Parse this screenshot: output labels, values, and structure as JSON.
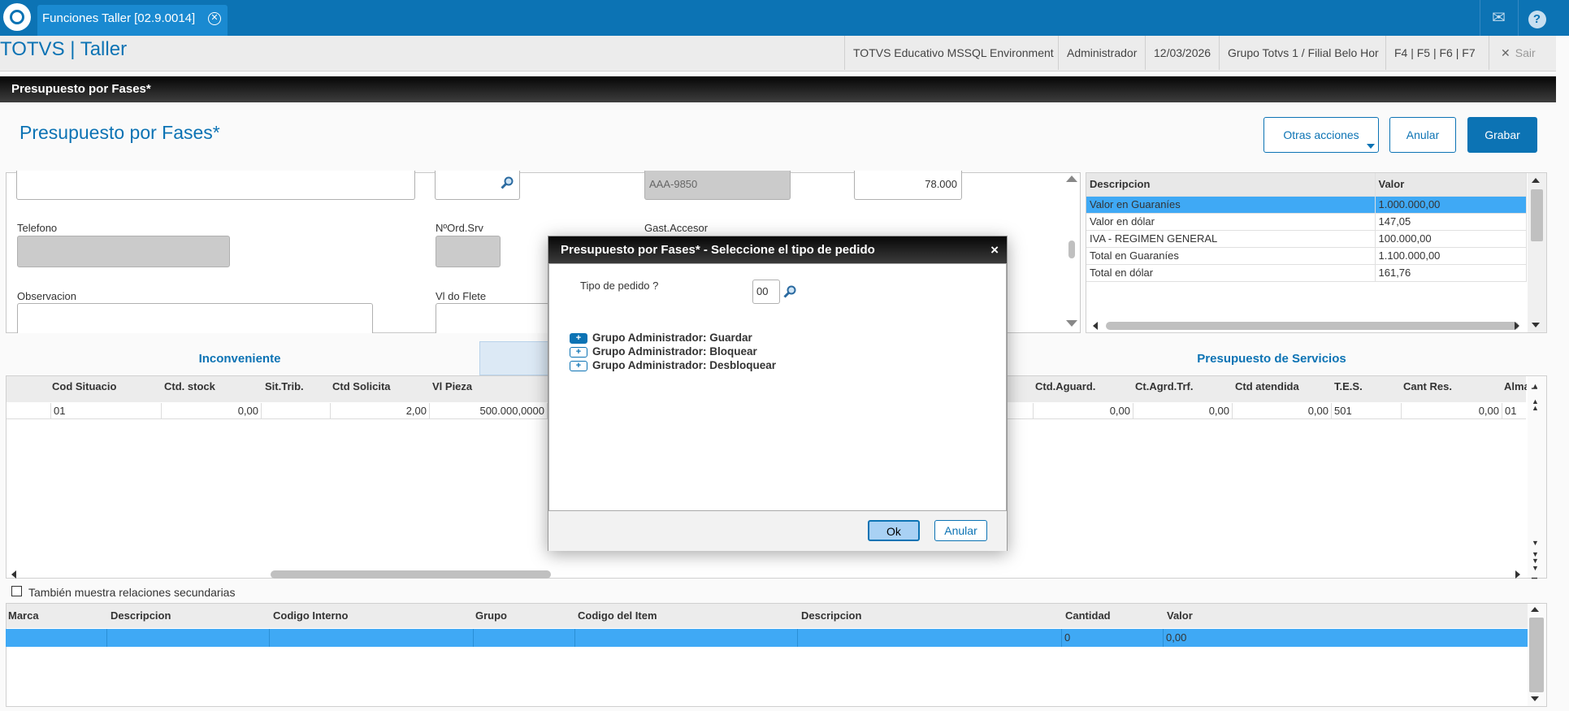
{
  "topbar": {
    "tab_label": "Funciones Taller [02.9.0014]",
    "close_glyph": "✕",
    "mail_glyph": "✉",
    "help_glyph": "?"
  },
  "header": {
    "app_title": "TOTVS | Taller",
    "environment": "TOTVS Educativo MSSQL Environment",
    "user": "Administrador",
    "date": "12/03/2026",
    "branch": "Grupo Totvs 1 / Filial Belo Hor",
    "shortcuts": "F4 | F5 | F6 | F7",
    "exit_label": "Sair",
    "exit_glyph": "✕"
  },
  "page": {
    "bar_title": "Presupuesto por Fases*",
    "form_title": "Presupuesto por Fases*"
  },
  "actions": {
    "other": "Otras acciones",
    "cancel": "Anular",
    "save": "Grabar"
  },
  "form": {
    "plate": "AAA-9850",
    "amount": "78.000",
    "label_telefono": "Telefono",
    "label_nordsrv": "NºOrd.Srv",
    "label_gastaccesor": "Gast.Accesor",
    "label_observacion": "Observacion",
    "label_vlflete": "Vl do Flete"
  },
  "summary": {
    "headers": [
      "Descripcion",
      "Valor"
    ],
    "rows": [
      [
        "Valor en Guaraníes",
        "1.000.000,00"
      ],
      [
        "Valor en dólar",
        "147,05"
      ],
      [
        "IVA - REGIMEN GENERAL",
        "100.000,00"
      ],
      [
        "Total en Guaraníes",
        "1.100.000,00"
      ],
      [
        "Total en dólar",
        "161,76"
      ]
    ]
  },
  "tabs": {
    "left": "Inconveniente",
    "right": "Presupuesto de Servicios"
  },
  "grid": {
    "headers": {
      "c1": "Cod Situacio",
      "c2": "Ctd. stock",
      "c3": "Sit.Trib.",
      "c4": "Ctd Solicita",
      "c5": "Vl Pieza",
      "c6": "Ctd.Aguard.",
      "c7": "Ct.Agrd.Trf.",
      "c8": "Ctd atendida",
      "c9": "T.E.S.",
      "c10": "Cant Res.",
      "c11": "Alma"
    },
    "row": {
      "c1": "01",
      "c2": "0,00",
      "c4": "2,00",
      "c5": "500.000,0000",
      "c6": "0,00",
      "c7": "0,00",
      "c8": "0,00",
      "c9": "501",
      "c10": "0,00",
      "c11": "01"
    }
  },
  "checkbox_label": "También muestra relaciones secundarias",
  "grid2": {
    "headers": {
      "c1": "Marca",
      "c2": "Descripcion",
      "c3": "Codigo Interno",
      "c4": "Grupo",
      "c5": "Codigo del Item",
      "c6": "Descripcion",
      "c7": "Cantidad",
      "c8": "Valor"
    },
    "row": {
      "c7": "0",
      "c8": "0,00"
    }
  },
  "modal": {
    "title": "Presupuesto por Fases* - Seleccione el tipo de pedido",
    "close_glyph": "×",
    "field_label": "Tipo de pedido ?",
    "field_value": "00",
    "tree": [
      "Grupo Administrador: Guardar",
      "Grupo Administrador: Bloquear",
      "Grupo Administrador: Desbloquear"
    ],
    "ok": "Ok",
    "cancel": "Anular"
  }
}
